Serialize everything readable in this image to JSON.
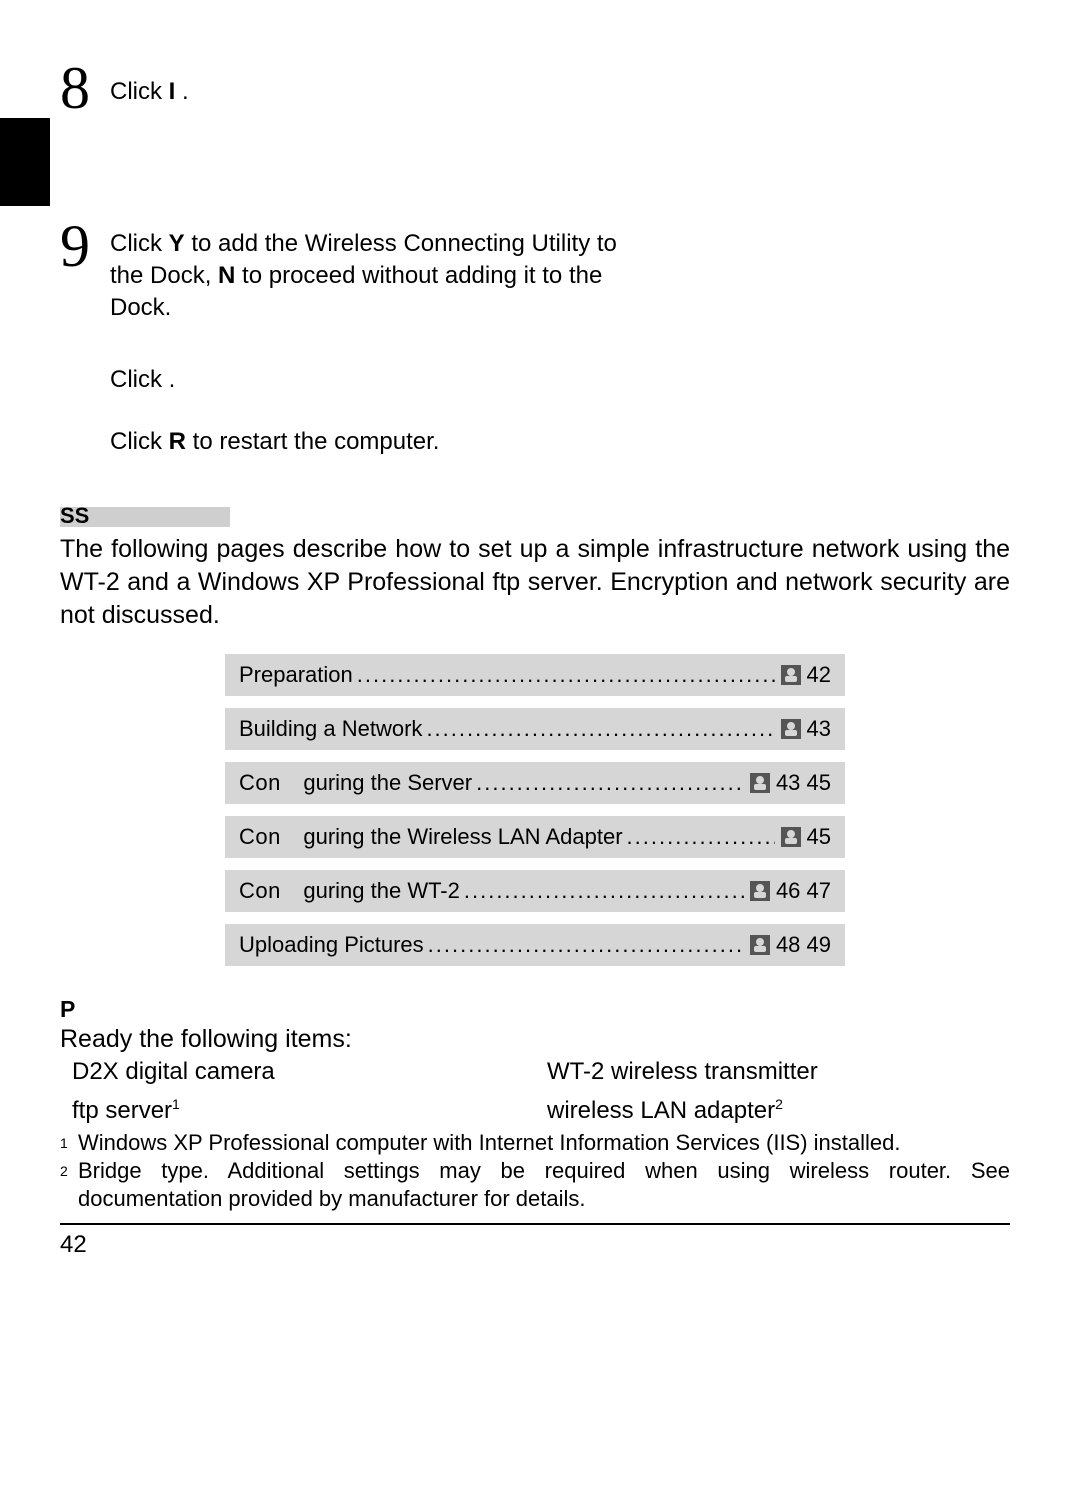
{
  "step8": {
    "num": "8",
    "pre": "Click ",
    "bold": "I",
    "post": "          ."
  },
  "step9": {
    "num": "9",
    "l1_pre": "Click ",
    "l1_bold": "Y",
    "l1_post": "     to add the Wireless Connecting Utility to",
    "l2_pre": "the Dock, ",
    "l2_bold": "N",
    "l2_post": "     to proceed without adding it to the",
    "l3": "Dock."
  },
  "para_click": "Click          .",
  "para_restart_pre": "Click ",
  "para_restart_bold": "R",
  "para_restart_post": "              to restart the computer.",
  "section_ss": "SS",
  "section_text": "The following pages describe how to set up a simple infrastructure network using the WT-2 and a Windows XP Professional ftp server.  Encryption and network security are not discussed.",
  "toc": [
    {
      "label": "Preparation",
      "confi": false,
      "page": "42"
    },
    {
      "label": "Building a Network",
      "confi": false,
      "page": "43"
    },
    {
      "label": "guring the Server ",
      "confi": true,
      "page": "43 45"
    },
    {
      "label": "guring the Wireless LAN Adapter ",
      "confi": true,
      "page": "45"
    },
    {
      "label": "guring the WT-2",
      "confi": true,
      "page": "46 47"
    },
    {
      "label": "Uploading Pictures",
      "confi": false,
      "page": "48 49"
    }
  ],
  "confi_prefix": "Con",
  "dots": "........................................................................................",
  "prep_head": "P",
  "prep_line": "Ready the following items:",
  "items": {
    "a1": "D2X digital camera",
    "a2_pre": "ftp server",
    "a2_sup": "1",
    "b1": "WT-2 wireless transmitter",
    "b2_pre": "wireless LAN adapter",
    "b2_sup": "2"
  },
  "footnotes": {
    "f1_mark": "1",
    "f1": "Windows XP Professional computer with Internet Information Services (IIS) installed.",
    "f2_mark": "2",
    "f2": "Bridge type.  Additional settings may be required when using wireless router.  See documentation provided by manufacturer for details."
  },
  "page_number": "42"
}
